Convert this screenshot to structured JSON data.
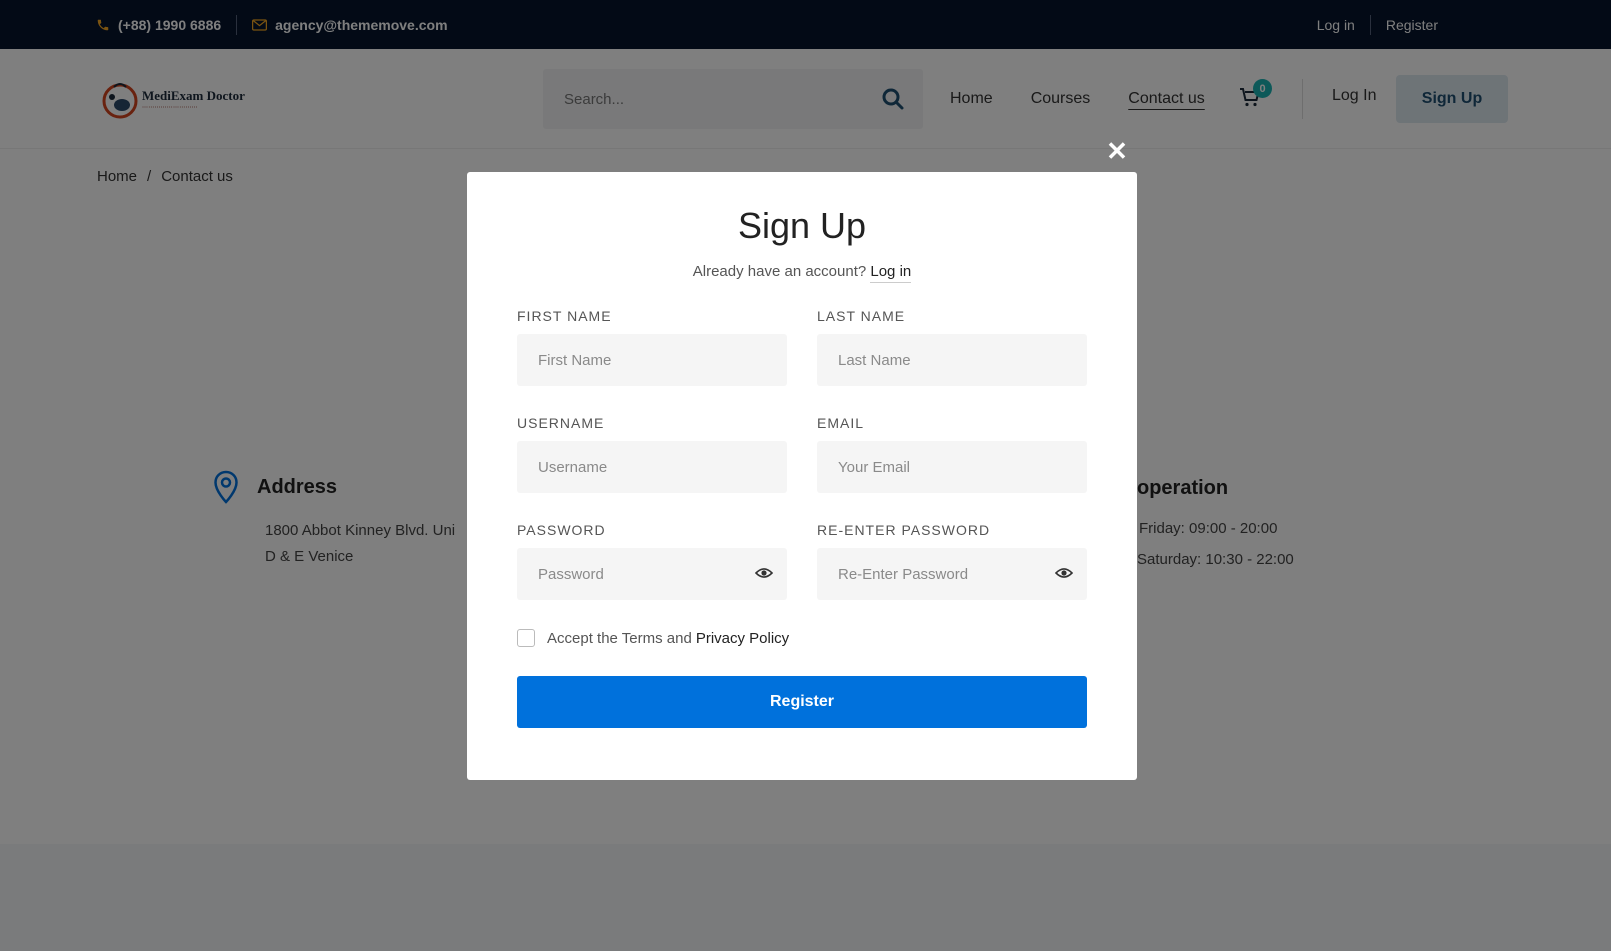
{
  "topbar": {
    "phone": "(+88) 1990 6886",
    "email": "agency@thememove.com",
    "login": "Log in",
    "register": "Register"
  },
  "header": {
    "logo_title": "MediExam Doctor",
    "search_placeholder": "Search...",
    "nav": [
      "Home",
      "Courses",
      "Contact us"
    ],
    "active_nav": "Contact us",
    "cart_count": "0",
    "login": "Log In",
    "signup": "Sign Up"
  },
  "breadcrumb": {
    "home": "Home",
    "sep": "/",
    "current": "Contact us"
  },
  "address": {
    "title": "Address",
    "line1": "1800 Abbot Kinney Blvd. Uni",
    "line2": "D & E Venice"
  },
  "hours": {
    "title": "operation",
    "line1": "Friday: 09:00 - 20:00",
    "line2": "Saturday: 10:30 - 22:00"
  },
  "modal": {
    "title": "Sign Up",
    "already": "Already have an account?",
    "login_link": "Log in",
    "fields": {
      "first_name": {
        "label": "FIRST NAME",
        "placeholder": "First Name"
      },
      "last_name": {
        "label": "LAST NAME",
        "placeholder": "Last Name"
      },
      "username": {
        "label": "USERNAME",
        "placeholder": "Username"
      },
      "email": {
        "label": "EMAIL",
        "placeholder": "Your Email"
      },
      "password": {
        "label": "PASSWORD",
        "placeholder": "Password"
      },
      "repassword": {
        "label": "RE-ENTER PASSWORD",
        "placeholder": "Re-Enter Password"
      }
    },
    "terms_prefix": "Accept the Terms and",
    "privacy": "Privacy Policy",
    "register": "Register",
    "close": "✕"
  },
  "colors": {
    "topbar": "#06152d",
    "accent_blue": "#0071dc",
    "teal_badge": "#1ab2b2",
    "signup_bg": "#dde8ef"
  }
}
